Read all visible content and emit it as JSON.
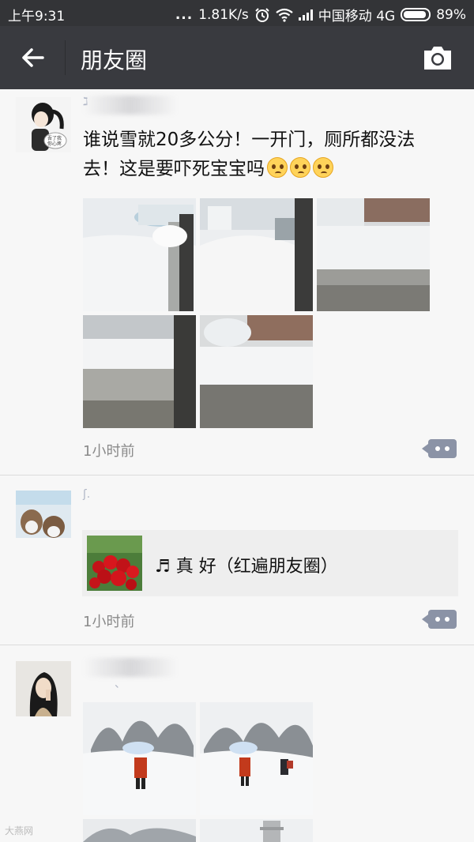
{
  "status_bar": {
    "time": "上午9:31",
    "dots": "...",
    "speed": "1.81K/s",
    "carrier": "中国移动 4G",
    "battery": "89%"
  },
  "nav": {
    "title": "朋友圈",
    "back_icon": "back-arrow-icon",
    "camera_icon": "camera-icon",
    "bg_color": "#393a3f"
  },
  "posts": [
    {
      "text": "谁说雪就20多公分！一开门，厕所都没法去！这是要吓死宝宝吗",
      "emoji_count": 3,
      "images": 5,
      "time": "1小时前",
      "name_fragment": "ℷ"
    },
    {
      "share_title": "♬ 真 好（红遍朋友圈）",
      "time": "1小时前",
      "name_fragment": "ʃ."
    },
    {
      "images": 4,
      "name_fragment": "、"
    }
  ],
  "watermark": "大燕网"
}
